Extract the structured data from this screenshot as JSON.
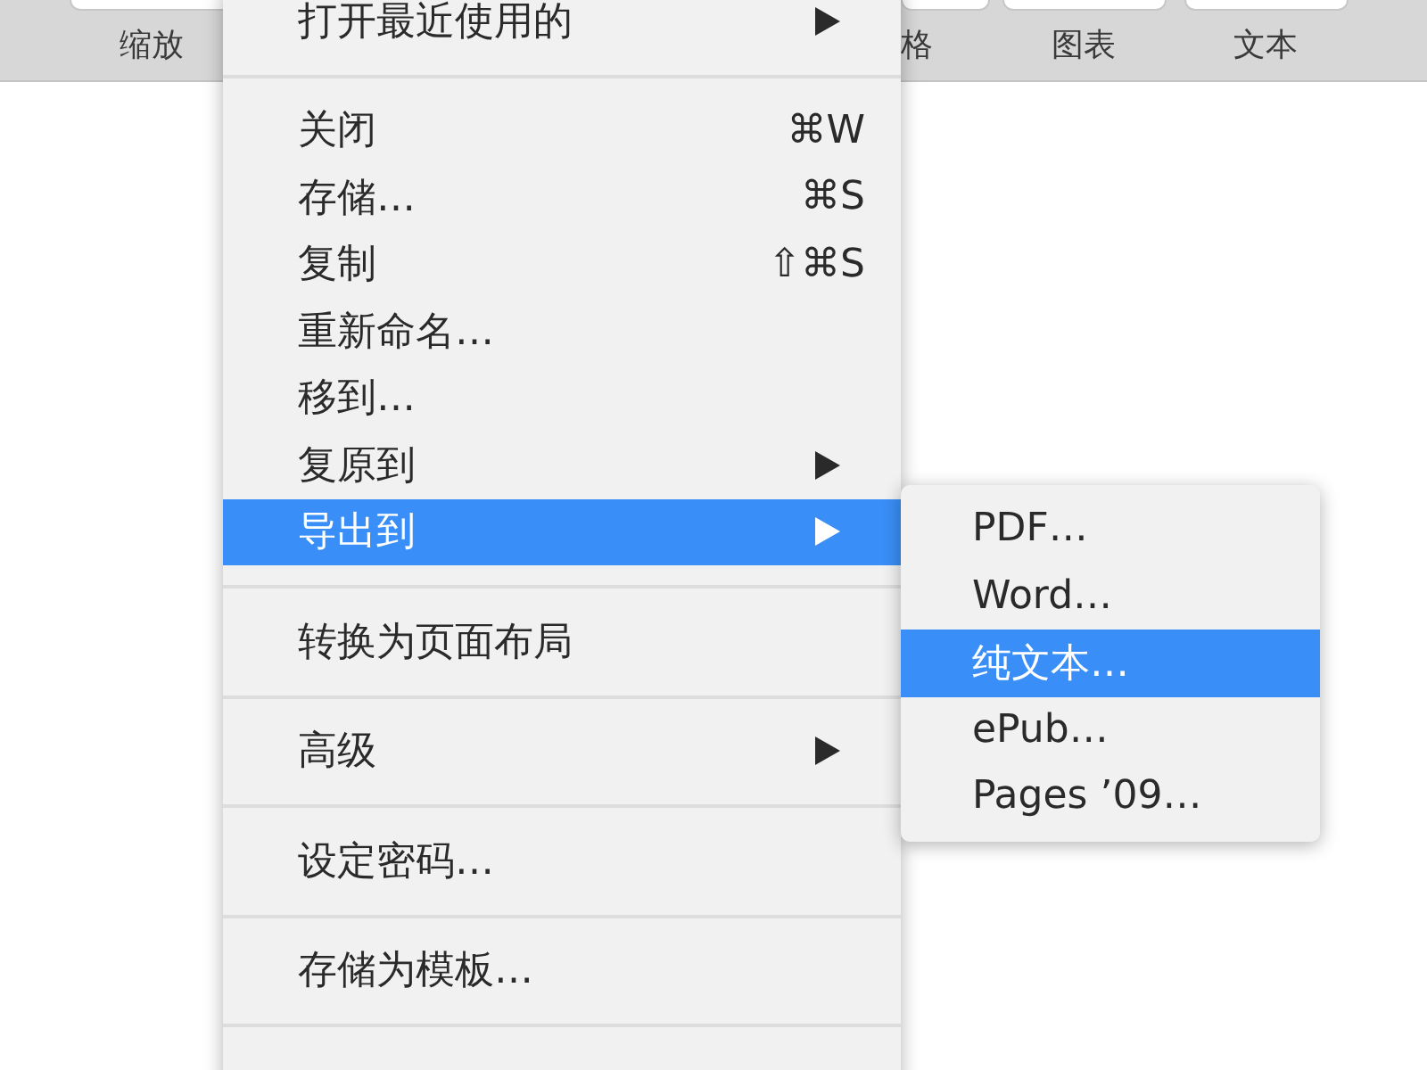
{
  "toolbar": {
    "left": [
      {
        "label": "缩放"
      }
    ],
    "right": [
      {
        "label": "格"
      },
      {
        "label": "图表"
      },
      {
        "label": "文本"
      }
    ]
  },
  "menu": {
    "sections": [
      {
        "items": [
          {
            "label": "打开最近使用的",
            "has_submenu": true,
            "selected": false
          }
        ]
      },
      {
        "items": [
          {
            "label": "关闭",
            "shortcut": "⌘W",
            "has_submenu": false,
            "selected": false
          },
          {
            "label": "存储…",
            "shortcut": "⌘S",
            "has_submenu": false,
            "selected": false
          },
          {
            "label": "复制",
            "shortcut": "⇧⌘S",
            "has_submenu": false,
            "selected": false
          },
          {
            "label": "重新命名…",
            "has_submenu": false,
            "selected": false
          },
          {
            "label": "移到…",
            "has_submenu": false,
            "selected": false
          },
          {
            "label": "复原到",
            "has_submenu": true,
            "selected": false
          },
          {
            "label": "导出到",
            "has_submenu": true,
            "selected": true
          }
        ]
      },
      {
        "items": [
          {
            "label": "转换为页面布局",
            "has_submenu": false,
            "selected": false
          }
        ]
      },
      {
        "items": [
          {
            "label": "高级",
            "has_submenu": true,
            "selected": false
          }
        ]
      },
      {
        "items": [
          {
            "label": "设定密码…",
            "has_submenu": false,
            "selected": false
          }
        ]
      },
      {
        "items": [
          {
            "label": "存储为模板…",
            "has_submenu": false,
            "selected": false
          }
        ]
      }
    ]
  },
  "submenu": {
    "items": [
      {
        "label": "PDF…",
        "selected": false
      },
      {
        "label": "Word…",
        "selected": false
      },
      {
        "label": "纯文本…",
        "selected": true
      },
      {
        "label": "ePub…",
        "selected": false
      },
      {
        "label": "Pages ’09…",
        "selected": false
      }
    ]
  }
}
